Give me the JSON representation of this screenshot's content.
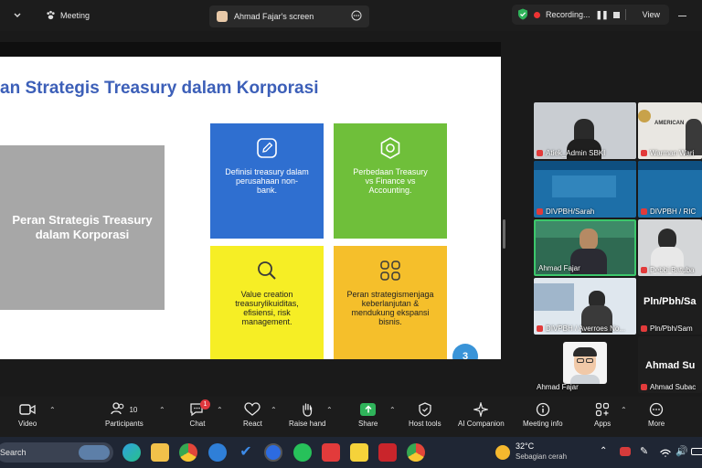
{
  "topbar": {
    "meeting_label": "Meeting",
    "screen_label": "Ahmad Fajar's screen",
    "recording_label": "Recording...",
    "view_label": "View"
  },
  "slide": {
    "title": "an Strategis Treasury dalam Korporasi",
    "left_box": "Peran Strategis Treasury dalam Korporasi",
    "cards": [
      {
        "text": "Definisi treasury dalam perusahaan non- bank.",
        "color": "#2f6fd0",
        "text_color": "#ffffff"
      },
      {
        "text": "Perbedaan Treasury vs Finance vs Accounting.",
        "color": "#6fbf3a",
        "text_color": "#ffffff"
      },
      {
        "text": "Value creation treasurylikuiditas, efisiensi, risk management.",
        "color": "#f6ee25",
        "text_color": "#222222"
      },
      {
        "text": "Peran strategismenjaga keberlanjutan & mendukung ekspansi bisnis.",
        "color": "#f5bf2b",
        "text_color": "#222222"
      }
    ],
    "page_number": "3"
  },
  "gallery": {
    "tiles": [
      {
        "name": "Atiek_Admin SBKI"
      },
      {
        "name": "Warman Wari"
      },
      {
        "name": "DIVPBH/Sarah"
      },
      {
        "name": "DIVPBH / RIC"
      },
      {
        "name": "Ahmad Fajar"
      },
      {
        "name": "Debbi Batuba"
      },
      {
        "name": "DIVPBH / Averroes No..."
      },
      {
        "name": "Pln/Pbh/Sam"
      },
      {
        "name": "Ahmad Fajar"
      },
      {
        "name": "Ahmad Subac"
      }
    ],
    "big_name_1": "Pln/Pbh/Sa",
    "big_name_2": "Ahmad Su",
    "banner_text": "AMERICAN"
  },
  "toolbar": {
    "video": "Video",
    "participants": "Participants",
    "participants_count": "10",
    "chat": "Chat",
    "chat_badge": "1",
    "react": "React",
    "raise_hand": "Raise hand",
    "share": "Share",
    "host_tools": "Host tools",
    "ai_companion": "AI Companion",
    "meeting_info": "Meeting info",
    "apps": "Apps",
    "more": "More"
  },
  "taskbar": {
    "search": "Search",
    "temp": "32°C",
    "weather": "Sebagian cerah"
  }
}
